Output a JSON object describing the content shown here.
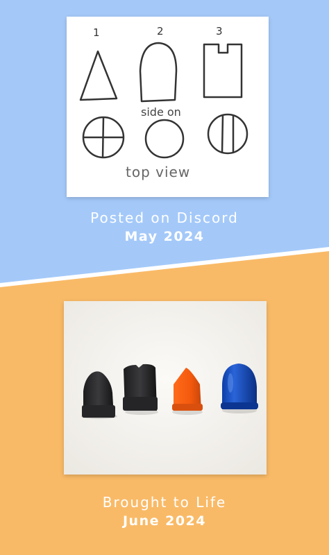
{
  "colors": {
    "top_background": "#a4c9f9",
    "bottom_background": "#f9ba67",
    "divider": "#ffffff",
    "caption_text": "#ffffff"
  },
  "sketch": {
    "numbers": [
      "1",
      "2",
      "3"
    ],
    "side_label": "side on",
    "top_label": "top view",
    "shapes_side": [
      "triangle",
      "rounded-arch",
      "notched-rectangle"
    ],
    "shapes_top": [
      "circle-with-cross",
      "plain-circle",
      "circle-with-two-vertical-lines"
    ]
  },
  "top_caption": {
    "line1": "Posted on Discord",
    "line2": "May 2024"
  },
  "photo": {
    "pieces": [
      "black-rounded-piece",
      "black-notched-piece",
      "orange-pointed-piece",
      "blue-rounded-piece"
    ]
  },
  "bottom_caption": {
    "line1": "Brought to Life",
    "line2": "June 2024"
  }
}
